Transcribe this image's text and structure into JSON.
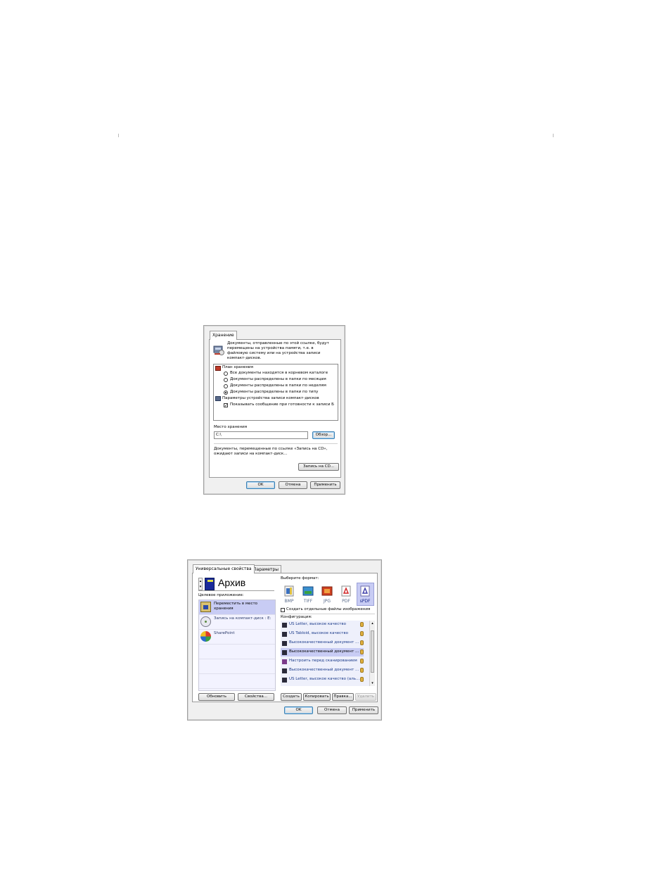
{
  "dialog1": {
    "tab": "Хранение",
    "description": [
      "Документы, отправленные по этой ссылке, будут",
      "перемещены на устройства памяти, т.е. в",
      "файловую систему или на устройства записи",
      "компакт-дисков."
    ],
    "plan_label": "План хранения",
    "options": [
      "Все документы находятся в корневом каталоге",
      "Документы распределены в папки по месяцам",
      "Документы распределены в папки по неделям",
      "Документы распределены в папки по типу"
    ],
    "selected_option_index": 3,
    "cd_params_label": "Параметры устройства записи компакт-дисков",
    "cd_checkbox_label": "Показывать сообщение при готовности к записи Б",
    "cd_checkbox_checked": true,
    "location_label": "Место хранения",
    "location_value": "C:\\",
    "browse_button": "Обзор...",
    "note": [
      "Документы, перемещенные по ссылке «Запись на CD»,",
      "ожидают записи на компакт-диск..."
    ],
    "burn_button": "Запись на CD...",
    "ok_button": "OK",
    "cancel_button": "Отмена",
    "apply_button": "Применить"
  },
  "dialog2": {
    "tabs": [
      "Универсальные свойства",
      "Параметры"
    ],
    "title": "Архив",
    "target_label": "Целевое приложение:",
    "targets": [
      {
        "label": [
          "Переместить в место",
          "хранения"
        ],
        "selected": true
      },
      {
        "label": [
          "Запись на компакт-диск : E:"
        ],
        "selected": false
      },
      {
        "label": [
          "SharePoint"
        ],
        "selected": false
      }
    ],
    "refresh_button": "Обновить",
    "properties_button": "Свойства...",
    "format_label": "Выберите формат:",
    "formats": [
      "BMP",
      "TIFF",
      "JPG",
      "PDF",
      "sPDF"
    ],
    "selected_format_index": 4,
    "separate_files_label": "Создать отдельные файлы изображения",
    "config_label": "Конфигурация:",
    "configs": [
      "US Letter, высокое качество",
      "US Tabloid, высокое качество",
      "Высококачественный документ ...",
      "Высококачественный документ ...",
      "Настроить перед сканированием",
      "Высококачественный документ ...",
      "US Letter, высокое качество (аль..."
    ],
    "selected_config_index": 3,
    "create_button": "Создать",
    "copy_button": "Копировать",
    "edit_button": "Правка...",
    "delete_button": "Удалить",
    "ok_button": "OK",
    "cancel_button": "Отмена",
    "apply_button": "Применить"
  }
}
